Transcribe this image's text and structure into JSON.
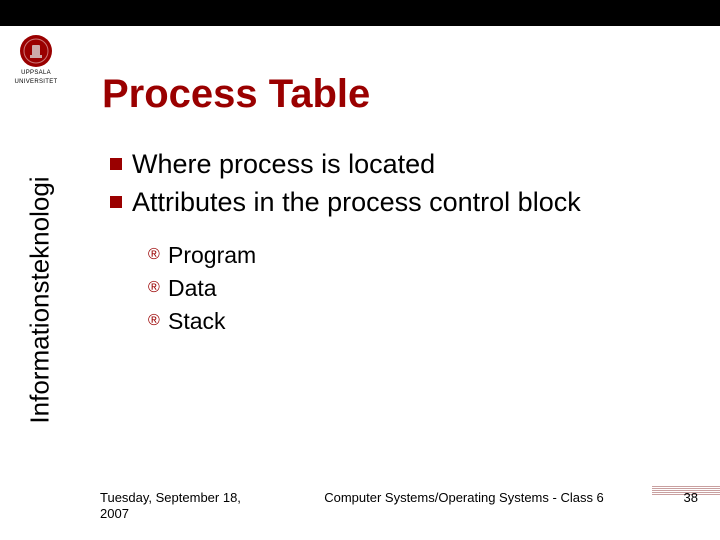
{
  "logo": {
    "line1": "UPPSALA",
    "line2": "UNIVERSITET"
  },
  "title": "Process Table",
  "sidebar_label": "Informationsteknologi",
  "bullets": [
    {
      "text": "Where process is located"
    },
    {
      "text": "Attributes in the process control block"
    }
  ],
  "sub_bullets": [
    {
      "text": "Program"
    },
    {
      "text": "Data"
    },
    {
      "text": "Stack"
    }
  ],
  "footer": {
    "date": "Tuesday, September 18, 2007",
    "center": "Computer Systems/Operating Systems - Class 6",
    "page": "38"
  }
}
